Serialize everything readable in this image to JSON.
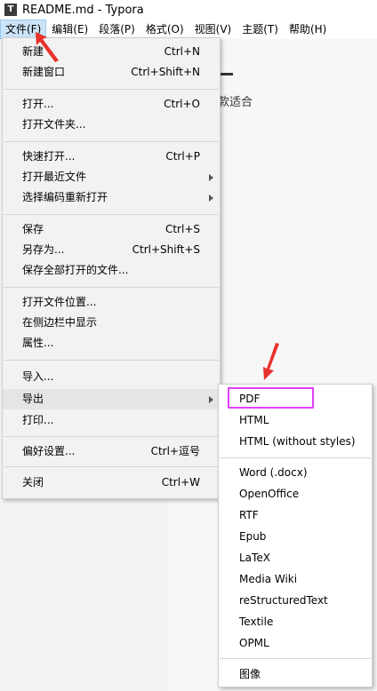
{
  "window": {
    "title": "README.md - Typora"
  },
  "menubar": [
    "文件(F)",
    "编辑(E)",
    "段落(P)",
    "格式(O)",
    "视图(V)",
    "主题(T)",
    "帮助(H)"
  ],
  "editor": {
    "visible_text": "款适合"
  },
  "file_menu": {
    "new": {
      "label": "新建",
      "shortcut": "Ctrl+N"
    },
    "new_window": {
      "label": "新建窗口",
      "shortcut": "Ctrl+Shift+N"
    },
    "open": {
      "label": "打开...",
      "shortcut": "Ctrl+O"
    },
    "open_folder": {
      "label": "打开文件夹..."
    },
    "quick_open": {
      "label": "快速打开...",
      "shortcut": "Ctrl+P"
    },
    "open_recent": {
      "label": "打开最近文件"
    },
    "reopen_encoding": {
      "label": "选择编码重新打开"
    },
    "save": {
      "label": "保存",
      "shortcut": "Ctrl+S"
    },
    "save_as": {
      "label": "另存为...",
      "shortcut": "Ctrl+Shift+S"
    },
    "save_all": {
      "label": "保存全部打开的文件..."
    },
    "open_location": {
      "label": "打开文件位置..."
    },
    "reveal_sidebar": {
      "label": "在侧边栏中显示"
    },
    "properties": {
      "label": "属性..."
    },
    "import": {
      "label": "导入..."
    },
    "export": {
      "label": "导出"
    },
    "print": {
      "label": "打印..."
    },
    "preferences": {
      "label": "偏好设置...",
      "shortcut": "Ctrl+逗号"
    },
    "close": {
      "label": "关闭",
      "shortcut": "Ctrl+W"
    }
  },
  "export_menu": {
    "pdf": "PDF",
    "html": "HTML",
    "html_no_styles": "HTML (without styles)",
    "word": "Word (.docx)",
    "openoffice": "OpenOffice",
    "rtf": "RTF",
    "epub": "Epub",
    "latex": "LaTeX",
    "mediawiki": "Media Wiki",
    "rst": "reStructuredText",
    "textile": "Textile",
    "opml": "OPML",
    "image": "图像"
  },
  "annotations": {
    "arrow_color": "#e8322b",
    "highlight_box_color": "#e040fb"
  }
}
